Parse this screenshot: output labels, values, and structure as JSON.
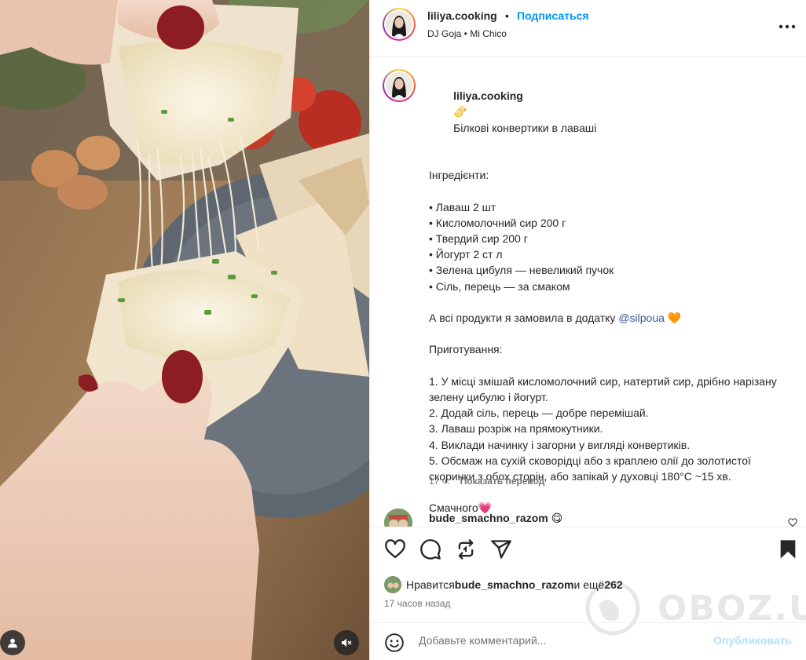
{
  "post": {
    "username": "liliya.cooking",
    "separator": "•",
    "follow_label": "Подписаться",
    "music": "DJ Goja • Mi Chico",
    "more_icon": "more-horizontal-icon"
  },
  "caption": {
    "username": "liliya.cooking",
    "title": "Білкові конвертики в лаваші",
    "title_emoji": "🫔",
    "lines": [
      "",
      "Інгредієнти:",
      "",
      "• Лаваш 2 шт",
      "• Кисломолочний сир 200 г",
      "• Твердий сир 200 г",
      "• Йогурт 2 ст л",
      "• Зелена цибуля — невеликий пучок",
      "• Сіль, перець — за смаком",
      ""
    ],
    "promo_prefix": "А всі продукти я замовила в додатку ",
    "promo_mention": "@silpoua",
    "promo_emoji": "🧡",
    "lines2": [
      "",
      "Приготування:",
      "",
      "1. У місці змішай кисломолочний сир, натертий сир, дрібно нарізану зелену цибулю і йогурт.",
      "2. Додай сіль, перець — добре перемішай.",
      "3. Лаваш розріж на прямокутники.",
      "4. Виклади начинку і загорни у вигляді конвертиків.",
      "5. Обсмаж на сухій сковорідці або з краплею олії до золотистої скоринки з обох сторін, або запікай у духовці 180°C ~15 хв.",
      "",
      "Смачного💗"
    ],
    "age": "17 ч.",
    "translate_label": "Показать перевод"
  },
  "comment": {
    "username": "bude_smachno_razom",
    "emoji": "😋"
  },
  "likes": {
    "prefix": "Нравится ",
    "user": "bude_smachno_razom",
    "middle": " и ещё ",
    "count": "262"
  },
  "time_ago": "17 часов назад",
  "add_comment": {
    "placeholder": "Добавьте комментарий...",
    "post_label": "Опубликовать"
  },
  "watermark": "OBOZ.UA",
  "colors": {
    "link": "#0095f6",
    "mention": "#385898",
    "muted": "#737373",
    "post_disabled": "#b2dffc"
  }
}
